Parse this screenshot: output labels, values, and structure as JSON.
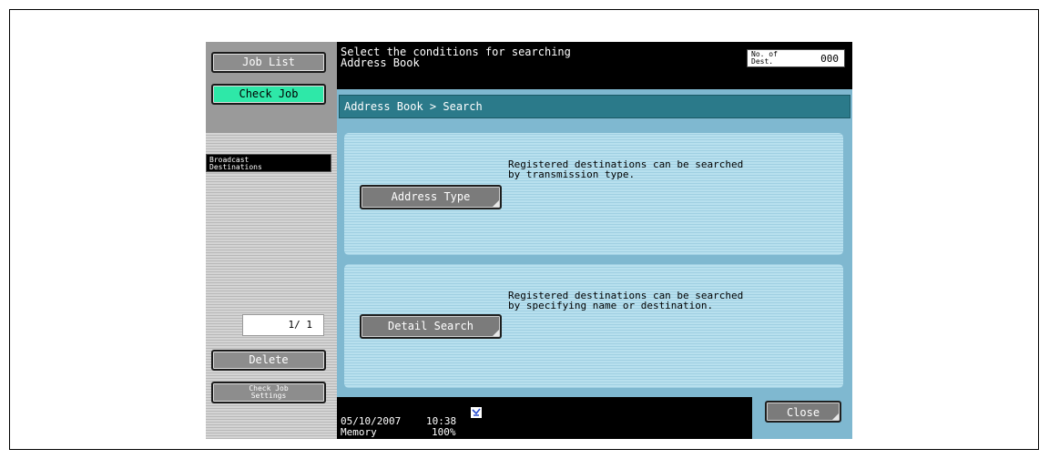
{
  "sidebar": {
    "job_list_label": "Job List",
    "check_job_label": "Check Job",
    "broadcast_label_line1": "Broadcast",
    "broadcast_label_line2": "Destinations",
    "page_indicator": "1/  1",
    "delete_label": "Delete",
    "check_job_settings_line1": "Check Job",
    "check_job_settings_line2": "Settings"
  },
  "header": {
    "message_line1": "Select the conditions for searching",
    "message_line2": "Address Book",
    "dest_label_line1": "No. of",
    "dest_label_line2": "Dest.",
    "dest_count": "000"
  },
  "breadcrumb": "Address Book > Search",
  "options": [
    {
      "button_label": "Address Type",
      "desc_line1": "Registered destinations can be searched",
      "desc_line2": "by transmission type."
    },
    {
      "button_label": "Detail Search",
      "desc_line1": "Registered destinations can be searched",
      "desc_line2": "by specifying name or destination."
    }
  ],
  "footer": {
    "date": "05/10/2007",
    "time": "10:38",
    "memory_label": "Memory",
    "memory_value": "100%",
    "close_label": "Close"
  },
  "colors": {
    "accent": "#2ee8a8",
    "breadcrumb_bg": "#2b7a8a",
    "main_bg": "#7fb8d0"
  }
}
